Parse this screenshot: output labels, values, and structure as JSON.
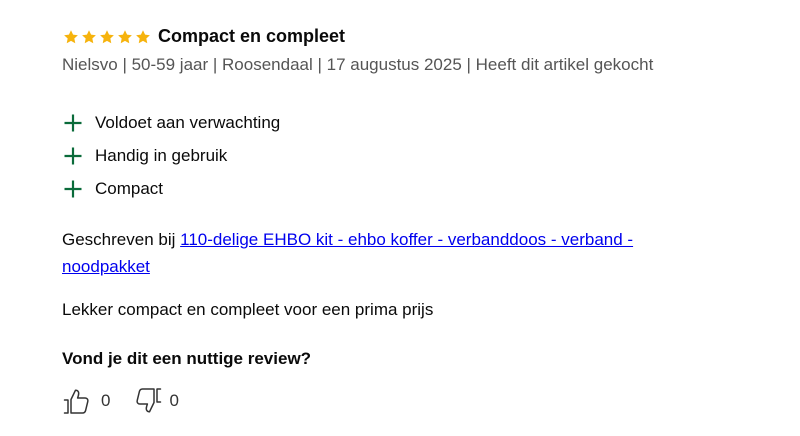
{
  "review": {
    "rating": 5,
    "rating_max": 5,
    "title": "Compact en compleet",
    "meta": "Nielsvo | 50-59 jaar | Roosendaal | 17 augustus 2025 | Heeft dit artikel gekocht",
    "pros": [
      "Voldoet aan verwachting",
      "Handig in gebruik",
      "Compact"
    ],
    "written_prefix": "Geschreven bij",
    "product_link": "110-delige EHBO kit - ehbo koffer - verbanddoos - verband - noodpakket",
    "text": "Lekker compact en compleet voor een prima prijs",
    "helpful_question": "Vond je dit een nuttige review?",
    "helpful_count": "0",
    "unhelpful_count": "0"
  },
  "colors": {
    "star": "#f6b30d",
    "plus": "#0a6b3a",
    "link": "#0000ee",
    "meta": "#555555"
  },
  "icons": {
    "star": "star-icon",
    "pro": "plus-icon",
    "helpful": "thumbs-up-icon",
    "unhelpful": "thumbs-down-icon"
  }
}
